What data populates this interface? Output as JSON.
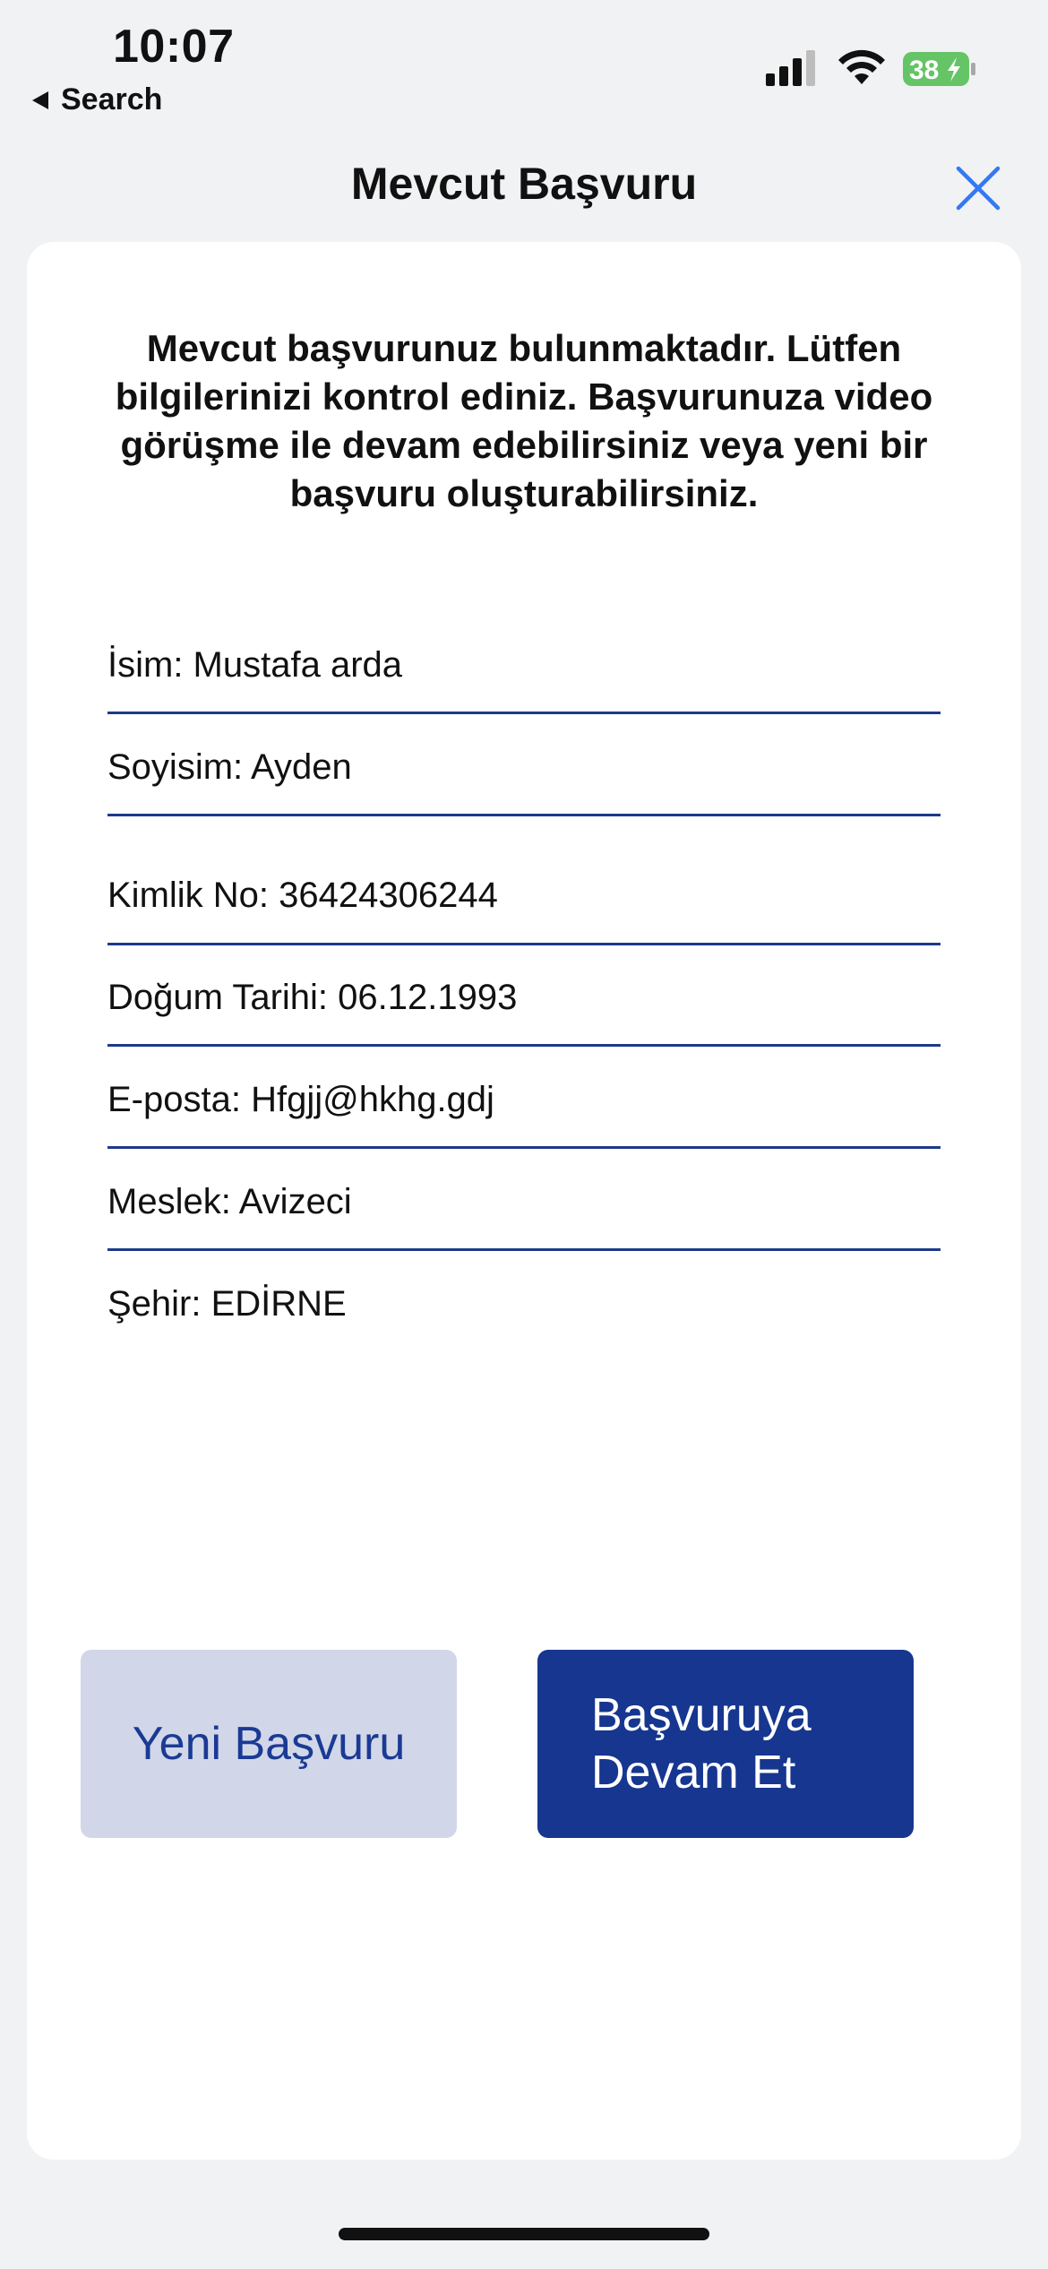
{
  "status_bar": {
    "time": "10:07",
    "back_label": "Search",
    "battery_level": "38",
    "battery_color": "#65c466"
  },
  "header": {
    "title": "Mevcut Başvuru"
  },
  "card": {
    "message": "Mevcut başvurunuz bulunmaktadır. Lütfen bilgilerinizi kontrol ediniz. Başvurunuza video görüşme ile devam edebilirsiniz veya yeni bir başvuru oluşturabilirsiniz.",
    "fields": [
      {
        "text": "İsim: Mustafa arda"
      },
      {
        "text": "Soyisim: Ayden"
      },
      {
        "text": "Kimlik No: 36424306244"
      },
      {
        "text": "Doğum Tarihi: 06.12.1993"
      },
      {
        "text": "E-posta: Hfgjj@hkhg.gdj"
      },
      {
        "text": "Meslek: Avizeci"
      },
      {
        "text": "Şehir: EDİRNE"
      }
    ]
  },
  "actions": {
    "new_application": "Yeni Başvuru",
    "continue_application": "Başvuruya Devam Et"
  },
  "colors": {
    "accent": "#16368f",
    "secondary_button": "#d1d7e8",
    "divider": "#1d3a8a",
    "close_icon": "#3478f6"
  }
}
